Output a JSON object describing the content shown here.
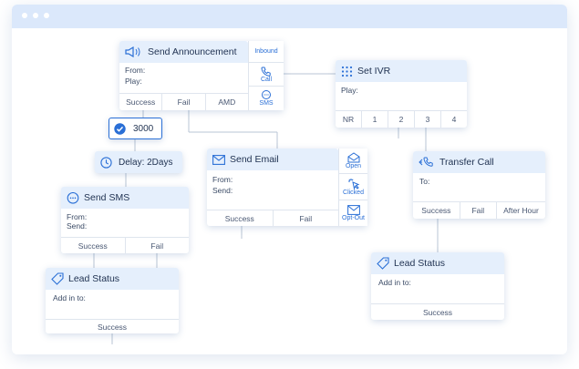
{
  "colors": {
    "accent": "#2a6fd6",
    "header_fill": "#e5effc",
    "titlebar": "#dbe8fb",
    "connector": "#b8c4d4"
  },
  "announcement": {
    "title": "Send Announcement",
    "fields": [
      "From:",
      "Play:"
    ],
    "outputs": [
      "Success",
      "Fail",
      "AMD"
    ],
    "side": [
      "Inbound",
      "Call",
      "SMS"
    ]
  },
  "ivr": {
    "title": "Set IVR",
    "fields": [
      "Play:"
    ],
    "outputs": [
      "NR",
      "1",
      "2",
      "3",
      "4"
    ]
  },
  "counter": {
    "value": "3000"
  },
  "delay": {
    "label": "Delay: 2Days"
  },
  "email": {
    "title": "Send Email",
    "fields": [
      "From:",
      "Send:"
    ],
    "outputs": [
      "Success",
      "Fail"
    ],
    "side": [
      "Open",
      "Clicked",
      "Opt-Out"
    ]
  },
  "transfer": {
    "title": "Transfer Call",
    "fields": [
      "To:"
    ],
    "outputs": [
      "Success",
      "Fail",
      "After Hour"
    ]
  },
  "sms": {
    "title": "Send SMS",
    "fields": [
      "From:",
      "Send:"
    ],
    "outputs": [
      "Success",
      "Fail"
    ]
  },
  "lead_left": {
    "title": "Lead Status",
    "fields": [
      "Add in to:"
    ],
    "outputs": [
      "Success"
    ]
  },
  "lead_right": {
    "title": "Lead Status",
    "fields": [
      "Add in to:"
    ],
    "outputs": [
      "Success"
    ]
  }
}
